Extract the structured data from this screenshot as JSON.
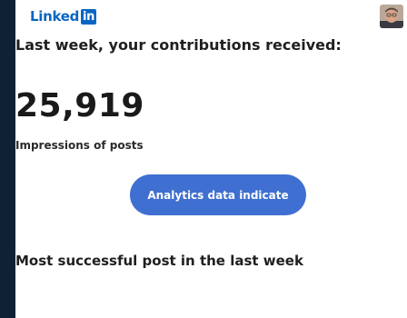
{
  "header": {
    "logo_word": "Linked",
    "logo_badge": "in"
  },
  "summary": {
    "headline": "Last week, your contributions received:",
    "impressions_count": "25,919",
    "impressions_label": "Impressions of posts",
    "cta_label": "Analytics data indicate"
  },
  "section": {
    "title": "Most successful post in the last week"
  },
  "colors": {
    "brand": "#0a66c2",
    "cta_background": "#3f6fd0",
    "side_background": "#0e2233"
  }
}
